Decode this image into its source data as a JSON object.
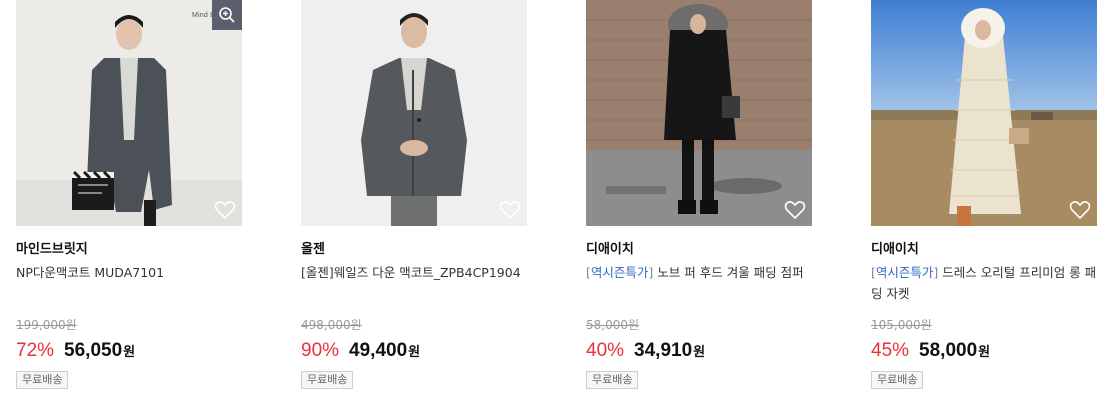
{
  "products": [
    {
      "image_alt": "man in dark grey single coat holding clapperboard",
      "brand_mark": "Mind B",
      "brand": "마인드브릿지",
      "title_tag": "",
      "title": "NP다운맥코트 MUDA7101",
      "original_price": "199,000원",
      "discount_rate": "72%",
      "price": "56,050",
      "currency": "원",
      "badge": "무료배송",
      "has_zoom": true
    },
    {
      "image_alt": "man in dark grey mac coat",
      "brand_mark": "",
      "brand": "올젠",
      "title_tag": "",
      "title": "[올젠]웨일즈 다운 맥코트_ZPB4CP1904",
      "original_price": "498,000원",
      "discount_rate": "90%",
      "price": "49,400",
      "currency": "원",
      "badge": "무료배송",
      "has_zoom": false
    },
    {
      "image_alt": "woman in black fur hood padding jumper",
      "brand_mark": "",
      "brand": "디애이치",
      "title_tag": "역시즌특가",
      "title": " 노브 퍼 후드 겨울 패딩 점퍼",
      "original_price": "58,000원",
      "discount_rate": "40%",
      "price": "34,910",
      "currency": "원",
      "badge": "무료배송",
      "has_zoom": false
    },
    {
      "image_alt": "woman in long white padded jacket with fur hood",
      "brand_mark": "",
      "brand": "디애이치",
      "title_tag": "역시즌특가",
      "title": " 드레스 오리털 프리미엄 롱 패딩 자켓",
      "original_price": "105,000원",
      "discount_rate": "45%",
      "price": "58,000",
      "currency": "원",
      "badge": "무료배송",
      "has_zoom": false
    }
  ],
  "colors": {
    "discount": "#e8313a",
    "tag": "#2f6cbf",
    "zoom_bg": "#5a5f6e"
  }
}
